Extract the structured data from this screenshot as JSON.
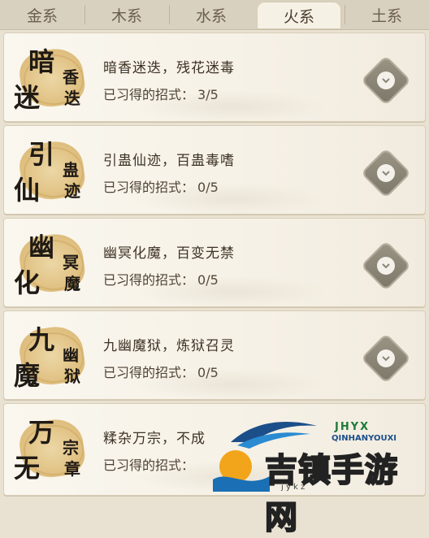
{
  "tabs": [
    {
      "label": "金系",
      "active": false
    },
    {
      "label": "木系",
      "active": false
    },
    {
      "label": "水系",
      "active": false
    },
    {
      "label": "火系",
      "active": true
    },
    {
      "label": "土系",
      "active": false
    }
  ],
  "progress_label": "已习得的招式：",
  "skills": [
    {
      "emblem": [
        "暗",
        "迷",
        "香",
        "迭"
      ],
      "title": "暗香迷迭，残花迷毒",
      "progress": "3/5"
    },
    {
      "emblem": [
        "引",
        "仙",
        "蛊",
        "迹"
      ],
      "title": "引蛊仙迹，百蛊毒嗜",
      "progress": "0/5"
    },
    {
      "emblem": [
        "幽",
        "化",
        "冥",
        "魔"
      ],
      "title": "幽冥化魔，百变无禁",
      "progress": "0/5"
    },
    {
      "emblem": [
        "九",
        "魔",
        "幽",
        "狱"
      ],
      "title": "九幽魔狱，炼狱召灵",
      "progress": "0/5"
    },
    {
      "emblem": [
        "万",
        "无",
        "宗",
        "章"
      ],
      "title": "糅杂万宗，不成",
      "progress": ""
    }
  ],
  "watermark": {
    "brand_small": "JHYX",
    "brand_pinyin": "QINHANYOUXI",
    "brand_big": "吉镇手游网",
    "site": "j    y     k    z"
  },
  "colors": {
    "accent": "#e1c284",
    "button": "#8a8577",
    "text": "#3e3226"
  }
}
